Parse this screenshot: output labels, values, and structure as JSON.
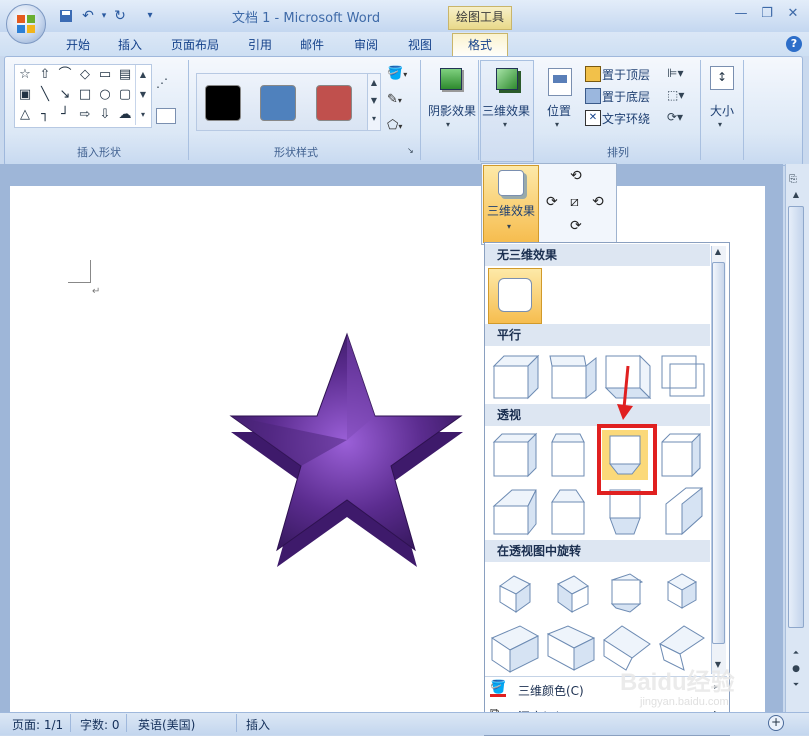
{
  "window": {
    "title": "文档 1 - Microsoft Word",
    "contextual_tab_group": "绘图工具",
    "controls": [
      "minimize-icon",
      "restore-icon",
      "close-icon"
    ]
  },
  "tabs": [
    "开始",
    "插入",
    "页面布局",
    "引用",
    "邮件",
    "审阅",
    "视图",
    "格式"
  ],
  "active_tab": "格式",
  "ribbon": {
    "groups": {
      "insert_shapes": "插入形状",
      "shape_styles": "形状样式",
      "arrange": "排列"
    },
    "swatch_colors": [
      "#000000",
      "#4f81bd",
      "#c0504d"
    ],
    "buttons": {
      "shadow_effect": "阴影效果",
      "threed_effect": "三维效果",
      "position": "位置",
      "bring_front": "置于顶层",
      "send_back": "置于底层",
      "text_wrap": "文字环绕",
      "size": "大小"
    }
  },
  "popup": {
    "threed_effect_label": "三维效果"
  },
  "gallery": {
    "sections": {
      "none": "无三维效果",
      "parallel": "平行",
      "perspective": "透视",
      "rotate": "在透视图中旋转"
    },
    "menu": {
      "color": "三维颜色(C)",
      "depth": "深度(D)"
    },
    "highlight_color": "#e02020"
  },
  "star": {
    "color": "#5b2c8f"
  },
  "status": {
    "page": "页面: 1/1",
    "words": "字数: 0",
    "language": "英语(美国)",
    "mode": "插入"
  },
  "watermark": {
    "brand": "Baidu经验",
    "url": "jingyan.baidu.com"
  }
}
